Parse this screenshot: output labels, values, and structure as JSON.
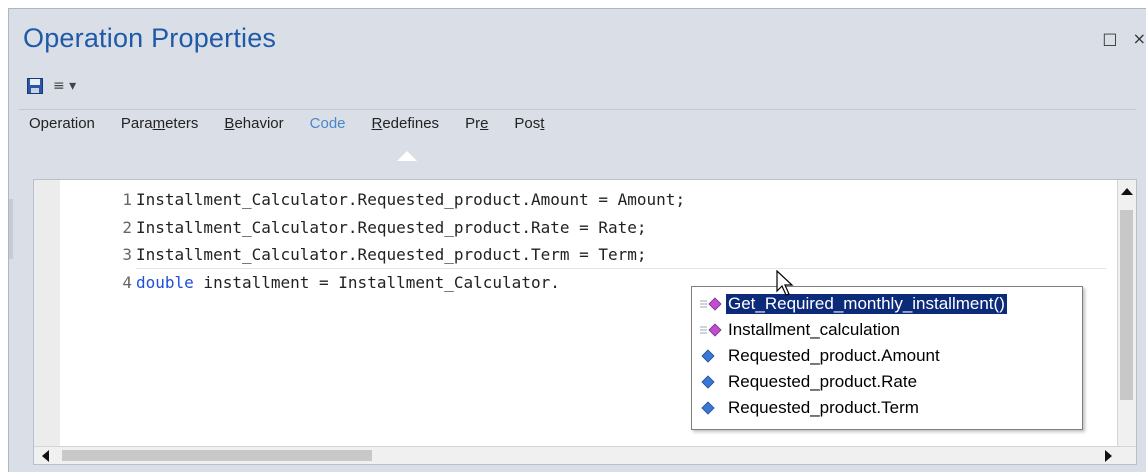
{
  "window": {
    "title": "Operation Properties",
    "restore_glyph": "□",
    "close_glyph": "×"
  },
  "toolbar": {
    "save_icon": "save-icon",
    "menu_glyph": "≡ ▾"
  },
  "tabs": [
    {
      "key": "operation",
      "pre": "Operation",
      "u": "",
      "post": "",
      "active": false
    },
    {
      "key": "parameters",
      "pre": "Para",
      "u": "m",
      "post": "eters",
      "active": false
    },
    {
      "key": "behavior",
      "pre": "",
      "u": "B",
      "post": "ehavior",
      "active": false
    },
    {
      "key": "code",
      "pre": "Code",
      "u": "",
      "post": "",
      "active": true
    },
    {
      "key": "redefines",
      "pre": "",
      "u": "R",
      "post": "edefines",
      "active": false
    },
    {
      "key": "pre",
      "pre": "Pr",
      "u": "e",
      "post": "",
      "active": false
    },
    {
      "key": "post",
      "pre": "Pos",
      "u": "t",
      "post": "",
      "active": false
    }
  ],
  "editor": {
    "lines": [
      {
        "num": "1",
        "keyword": "",
        "text": "Installment_Calculator.Requested_product.Amount = Amount;"
      },
      {
        "num": "2",
        "keyword": "",
        "text": "Installment_Calculator.Requested_product.Rate = Rate;"
      },
      {
        "num": "3",
        "keyword": "",
        "text": "Installment_Calculator.Requested_product.Term = Term;"
      },
      {
        "num": "4",
        "keyword": "double",
        "text": " installment = Installment_Calculator."
      }
    ],
    "keyword_color": "#1f4fd8"
  },
  "autocomplete": {
    "items": [
      {
        "label": "Get_Required_monthly_installment()",
        "icon": "method-icon",
        "selected": true
      },
      {
        "label": "Installment_calculation",
        "icon": "method-icon",
        "selected": false
      },
      {
        "label": "Requested_product.Amount",
        "icon": "attribute-icon",
        "selected": false
      },
      {
        "label": "Requested_product.Rate",
        "icon": "attribute-icon",
        "selected": false
      },
      {
        "label": "Requested_product.Term",
        "icon": "attribute-icon",
        "selected": false
      }
    ],
    "selected_bg": "#0c2a7a"
  },
  "colors": {
    "title": "#1e5aa8",
    "active_tab": "#4b86c9",
    "panel_bg": "#dadfe7"
  }
}
